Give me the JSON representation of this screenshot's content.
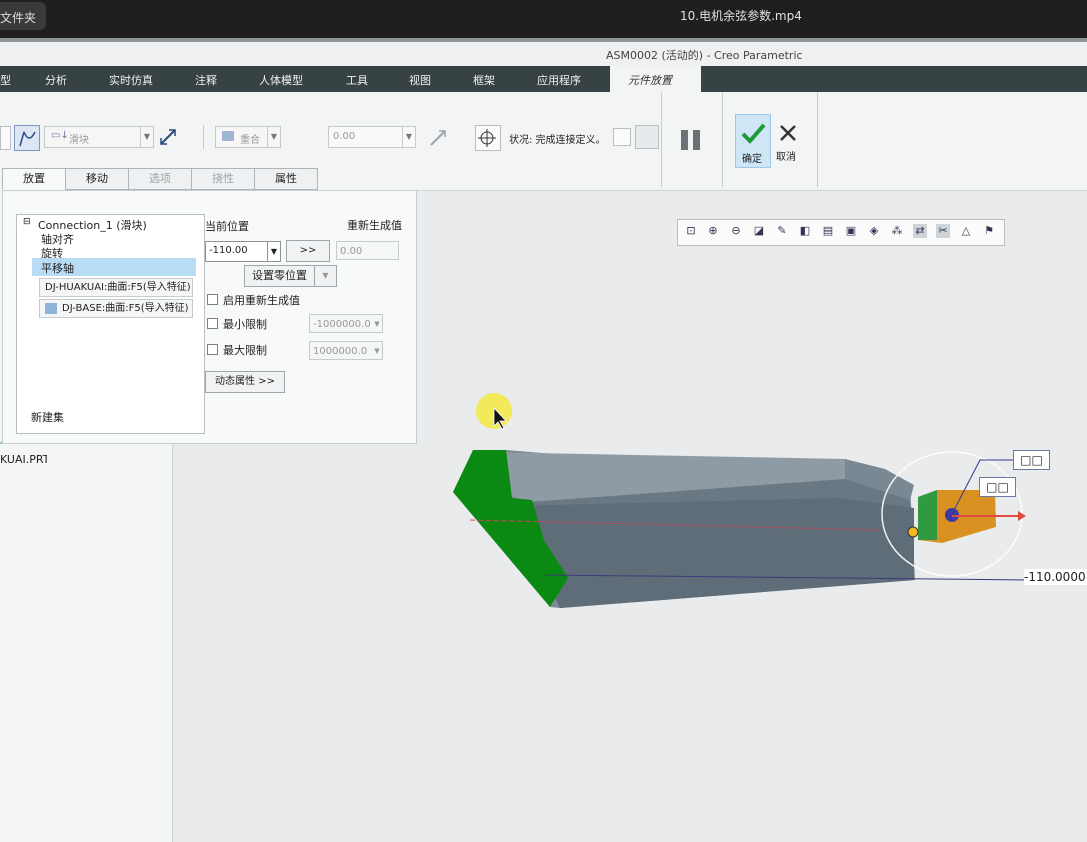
{
  "video": {
    "folder_label": "文件夹",
    "title": "10.电机余弦参数.mp4"
  },
  "window": {
    "title": "ASM0002 (活动的) - Creo Parametric"
  },
  "menu": {
    "items": [
      "型",
      "分析",
      "实时仿真",
      "注释",
      "人体模型",
      "工具",
      "视图",
      "框架",
      "应用程序"
    ],
    "active_tab": "元件放置"
  },
  "ribbon": {
    "connection_type": "滑块",
    "constraint_type": "重合",
    "offset_value": "0.00",
    "status_label": "状况: 完成连接定义。",
    "ok_label": "确定",
    "cancel_label": "取消"
  },
  "subtabs": [
    "放置",
    "移动",
    "选项",
    "挠性",
    "属性"
  ],
  "panel": {
    "tree": {
      "connection": "Connection_1 (滑块)",
      "items": [
        "轴对齐",
        "旋转",
        "平移轴"
      ],
      "selected_index": 2,
      "refs": [
        "DJ-HUAKUAI:曲面:F5(导入特征)",
        "DJ-BASE:曲面:F5(导入特征)"
      ],
      "new_set": "新建集"
    },
    "current_pos_label": "当前位置",
    "regen_label": "重新生成值",
    "current_pos_value": "-110.00",
    "arrow_btn": ">>",
    "regen_value": "0.00",
    "set_zero_btn": "设置零位置",
    "enable_regen": "启用重新生成值",
    "min_limit": "最小限制",
    "min_value": "-1000000.0",
    "max_limit": "最大限制",
    "max_value": "1000000.0",
    "dynamic_btn": "动态属性 >>"
  },
  "left_tree": {
    "part_label": "KUAI.PRT"
  },
  "viewport": {
    "dimension_label": "-110.0000",
    "box_labels": [
      "□□",
      "□□"
    ]
  },
  "colors": {
    "accent_green": "#0a8a12",
    "body_gray": "#6f7f8a",
    "slider_orange": "#d99222",
    "menu_dark": "#364244"
  }
}
